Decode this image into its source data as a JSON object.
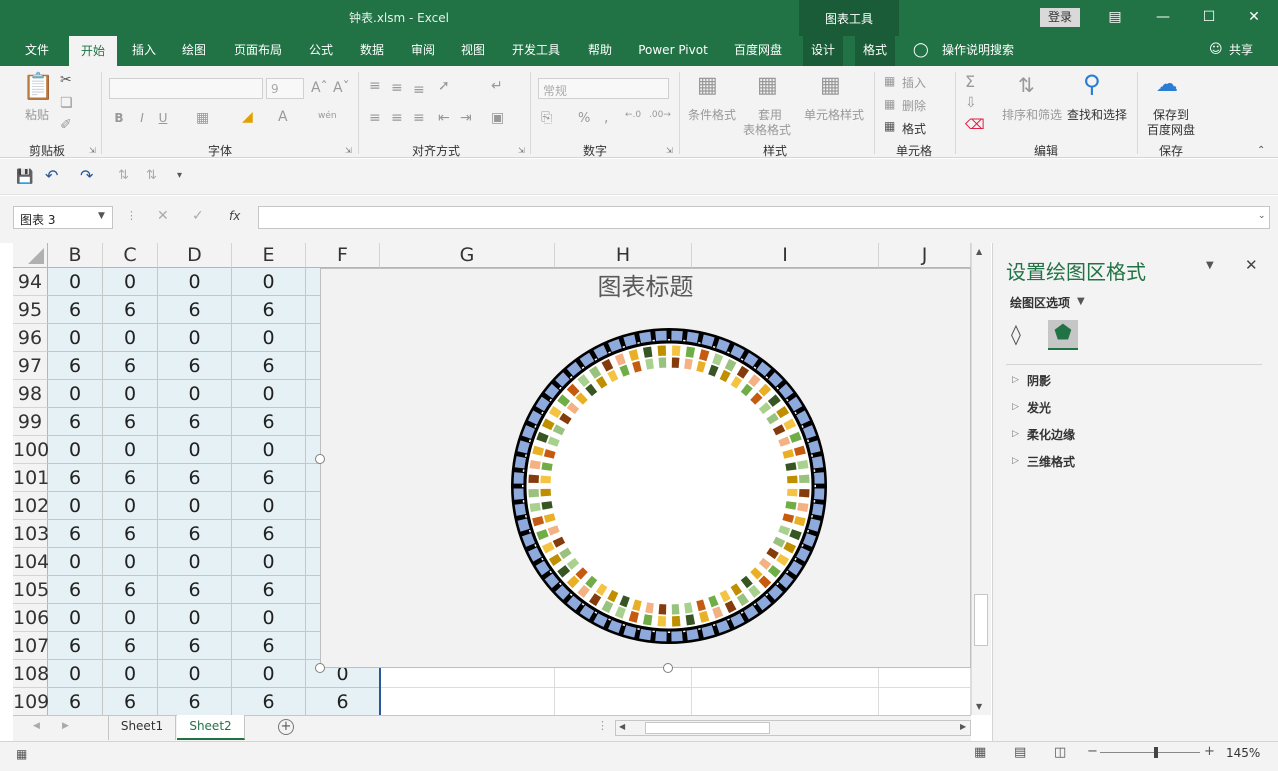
{
  "window": {
    "title": "钟表.xlsm  -  Excel",
    "context_tools_label": "图表工具",
    "login": "登录"
  },
  "tabs": [
    "文件",
    "开始",
    "插入",
    "绘图",
    "页面布局",
    "公式",
    "数据",
    "审阅",
    "视图",
    "开发工具",
    "帮助",
    "Power Pivot",
    "百度网盘",
    "设计",
    "格式"
  ],
  "active_tab": "开始",
  "tell_me": "操作说明搜索",
  "share": "共享",
  "ribbon": {
    "clipboard": {
      "paste": "粘贴",
      "group": "剪贴板"
    },
    "font": {
      "name": "",
      "size": "9",
      "bold": "B",
      "italic": "I",
      "underline": "U",
      "phonetic": "wén",
      "group": "字体"
    },
    "alignment": {
      "group": "对齐方式"
    },
    "number": {
      "format": "常规",
      "percent": "%",
      "group": "数字"
    },
    "styles": {
      "conditional": "条件格式",
      "table_line1": "套用",
      "table_line2": "表格格式",
      "cell_styles": "单元格样式",
      "group": "样式"
    },
    "cells": {
      "insert": "插入",
      "delete": "删除",
      "format": "格式",
      "group": "单元格"
    },
    "editing": {
      "sort_filter": "排序和筛选",
      "find_select": "查找和选择",
      "group": "编辑"
    },
    "save": {
      "line1": "保存到",
      "line2": "百度网盘",
      "group": "保存"
    }
  },
  "formula_bar": {
    "name_box": "图表 3",
    "fx": "fx",
    "formula": ""
  },
  "columns": [
    "B",
    "C",
    "D",
    "E",
    "F",
    "G",
    "H",
    "I",
    "J"
  ],
  "rows": [
    {
      "n": "94",
      "v": [
        "0",
        "0",
        "0",
        "0"
      ]
    },
    {
      "n": "95",
      "v": [
        "6",
        "6",
        "6",
        "6"
      ]
    },
    {
      "n": "96",
      "v": [
        "0",
        "0",
        "0",
        "0"
      ]
    },
    {
      "n": "97",
      "v": [
        "6",
        "6",
        "6",
        "6"
      ]
    },
    {
      "n": "98",
      "v": [
        "0",
        "0",
        "0",
        "0"
      ]
    },
    {
      "n": "99",
      "v": [
        "6",
        "6",
        "6",
        "6"
      ]
    },
    {
      "n": "100",
      "v": [
        "0",
        "0",
        "0",
        "0"
      ]
    },
    {
      "n": "101",
      "v": [
        "6",
        "6",
        "6",
        "6"
      ]
    },
    {
      "n": "102",
      "v": [
        "0",
        "0",
        "0",
        "0"
      ]
    },
    {
      "n": "103",
      "v": [
        "6",
        "6",
        "6",
        "6"
      ]
    },
    {
      "n": "104",
      "v": [
        "0",
        "0",
        "0",
        "0"
      ]
    },
    {
      "n": "105",
      "v": [
        "6",
        "6",
        "6",
        "6"
      ]
    },
    {
      "n": "106",
      "v": [
        "0",
        "0",
        "0",
        "0"
      ]
    },
    {
      "n": "107",
      "v": [
        "6",
        "6",
        "6",
        "6"
      ]
    },
    {
      "n": "108",
      "v": [
        "0",
        "0",
        "0",
        "0",
        "0"
      ]
    },
    {
      "n": "109",
      "v": [
        "6",
        "6",
        "6",
        "6",
        "6"
      ]
    }
  ],
  "chart": {
    "title": "图表标题",
    "outer_ring_segments": 60,
    "middle_ring_segments": 60,
    "outer_color": "#8ea9db",
    "ring_border_color": "#000000",
    "palette": [
      "#f5c342",
      "#e9b026",
      "#98c27d",
      "#70ad47",
      "#375623",
      "#843c0c",
      "#c55a11",
      "#bf8f00",
      "#f4b183",
      "#a9d18e"
    ]
  },
  "pane": {
    "title": "设置绘图区格式",
    "options": "绘图区选项",
    "items": [
      "阴影",
      "发光",
      "柔化边缘",
      "三维格式"
    ]
  },
  "sheets": [
    "Sheet1",
    "Sheet2"
  ],
  "active_sheet": "Sheet2",
  "status": {
    "zoom": "145%"
  }
}
